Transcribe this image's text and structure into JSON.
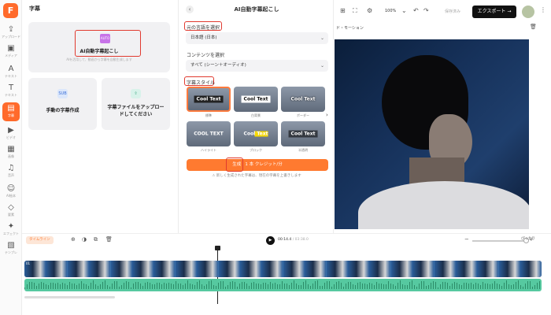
{
  "sidebar": {
    "logo": "F",
    "items": [
      {
        "icon": "upload-icon",
        "glyph": "⇪",
        "label": "アップロード"
      },
      {
        "icon": "media-icon",
        "glyph": "▣",
        "label": "メディア"
      },
      {
        "icon": "audio-icon",
        "glyph": "A",
        "label": "テキスト"
      },
      {
        "icon": "text-icon",
        "glyph": "T",
        "label": "テキスト"
      },
      {
        "icon": "captions-icon",
        "glyph": "▤",
        "label": "字幕"
      },
      {
        "icon": "video-icon",
        "glyph": "▶",
        "label": "ビデオ"
      },
      {
        "icon": "image-icon",
        "glyph": "▦",
        "label": "画像"
      },
      {
        "icon": "music-icon",
        "glyph": "♫",
        "label": "音声"
      },
      {
        "icon": "sticker-icon",
        "glyph": "☺",
        "label": "AI絵本"
      },
      {
        "icon": "shapes-icon",
        "glyph": "◇",
        "label": "要素"
      },
      {
        "icon": "effects-icon",
        "glyph": "✦",
        "label": "エフェクト"
      },
      {
        "icon": "template-icon",
        "glyph": "▧",
        "label": "テンプレ"
      }
    ]
  },
  "panel1": {
    "title": "字幕",
    "auto_card": {
      "badge": "AUTO",
      "title": "AI自動字幕起こし",
      "subtitle": "AIを活用して、動画から字幕を自動生成します"
    },
    "manual_card": {
      "title": "手動の字幕作成"
    },
    "upload_card": {
      "title": "字幕ファイルをアップロードしてください"
    }
  },
  "panel2": {
    "title": "AI自動字幕起こし",
    "language_label": "元の言語を選択",
    "language_value": "日本語 (日本)",
    "content_label": "コンテンツを選択",
    "content_value": "すべて (シーン＋オーディオ)",
    "style_label": "字幕スタイル",
    "styles": [
      {
        "text": "Cool Text",
        "label": "標準"
      },
      {
        "text": "Cool Text",
        "label": "白背景"
      },
      {
        "text": "Cool Text",
        "label": "ボーダー"
      },
      {
        "text": "COOL TEXT",
        "label": "ハイライト"
      },
      {
        "text": "Cool Text",
        "label": "ブロック"
      },
      {
        "text": "Cool Text",
        "label": "半透明"
      }
    ],
    "generate_label": "生成 · 1 本 クレジット/分",
    "warning": "新しく生成された字幕は、現在の字幕を上書きします"
  },
  "topbar": {
    "zoom": "100%",
    "save": "保存済み",
    "export": "エクスポート →",
    "subhead": "ド・モーション"
  },
  "timeline": {
    "chip": "タイムライン",
    "current": "00:14.4",
    "total": "/ 03:38.0",
    "fit": "ぴったり",
    "track_label": "01"
  },
  "colors": {
    "accent": "#ff7a30",
    "highlight": "#e03a2f",
    "video_track": "#3a6fa8",
    "audio_track": "#56c9a0"
  }
}
